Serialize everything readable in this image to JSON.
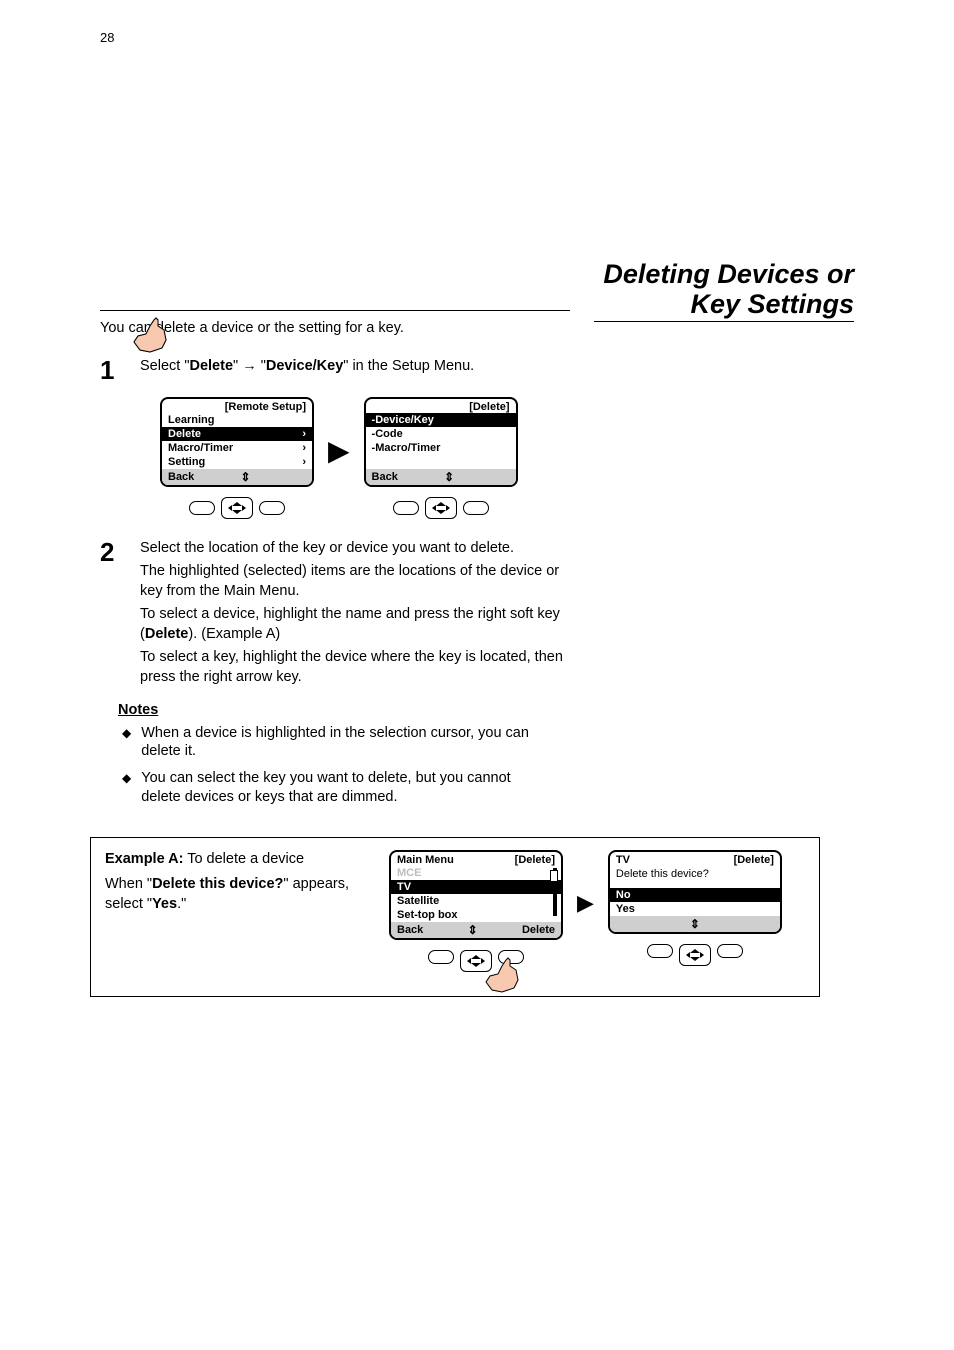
{
  "page_number": "28",
  "heading": "Deleting Devices or Key Settings",
  "intro": "You can delete a device or the setting for a key.",
  "step1": {
    "num": "1",
    "text_before": "Select \"",
    "bold1": "Delete",
    "mid1": "\" → \"",
    "bold2": "Device/Key",
    "text_after": "\" in the Setup Menu."
  },
  "screen1": {
    "title": "[Remote Setup]",
    "items": [
      {
        "label": "Learning",
        "selected": false,
        "chevron": false
      },
      {
        "label": "Delete",
        "selected": true,
        "chevron": true
      },
      {
        "label": "Macro/Timer",
        "selected": false,
        "chevron": true
      },
      {
        "label": "Setting",
        "selected": false,
        "chevron": true
      }
    ],
    "footer_left": "Back"
  },
  "screen2": {
    "title": "[Delete]",
    "items": [
      {
        "label": "-Device/Key",
        "selected": true
      },
      {
        "label": "-Code",
        "selected": false
      },
      {
        "label": "-Macro/Timer",
        "selected": false
      }
    ],
    "footer_left": "Back"
  },
  "step2": {
    "num": "2",
    "line1": "Select the location of the key or device you want to delete.",
    "line2": "The highlighted (selected) items are the locations of the device or key from the Main Menu.",
    "line3_before": "To select a device, highlight the name and press the right soft key (",
    "line3_bold": "Delete",
    "line3_after": "). (Example A)",
    "line4": "To select a key, highlight the device where the key is located, then press the right arrow key."
  },
  "notes": {
    "heading": "Notes",
    "n1": "When a device is highlighted in the selection cursor, you can delete it.",
    "n2": "You can select the key you want to delete, but you cannot delete devices or keys that are dimmed."
  },
  "case": {
    "label": "Example A:",
    "text": " To delete a device",
    "line_before": "When \"",
    "line_bold": "Delete this device?",
    "line_mid": "\" appears, select \"",
    "line_bold2": "Yes",
    "line_after": ".\""
  },
  "screen3": {
    "header_left": "Main Menu",
    "header_right": "[Delete]",
    "items": [
      {
        "label": "MCE",
        "selected": false,
        "dim": true
      },
      {
        "label": "TV",
        "selected": true
      },
      {
        "label": "Satellite",
        "selected": false
      },
      {
        "label": "Set-top box",
        "selected": false
      }
    ],
    "footer_left": "Back",
    "footer_right": "Delete"
  },
  "screen4": {
    "header_left": "TV",
    "header_right": "[Delete]",
    "prompt": "Delete this device?",
    "items": [
      {
        "label": "No",
        "selected": true
      },
      {
        "label": "Yes",
        "selected": false
      }
    ]
  }
}
